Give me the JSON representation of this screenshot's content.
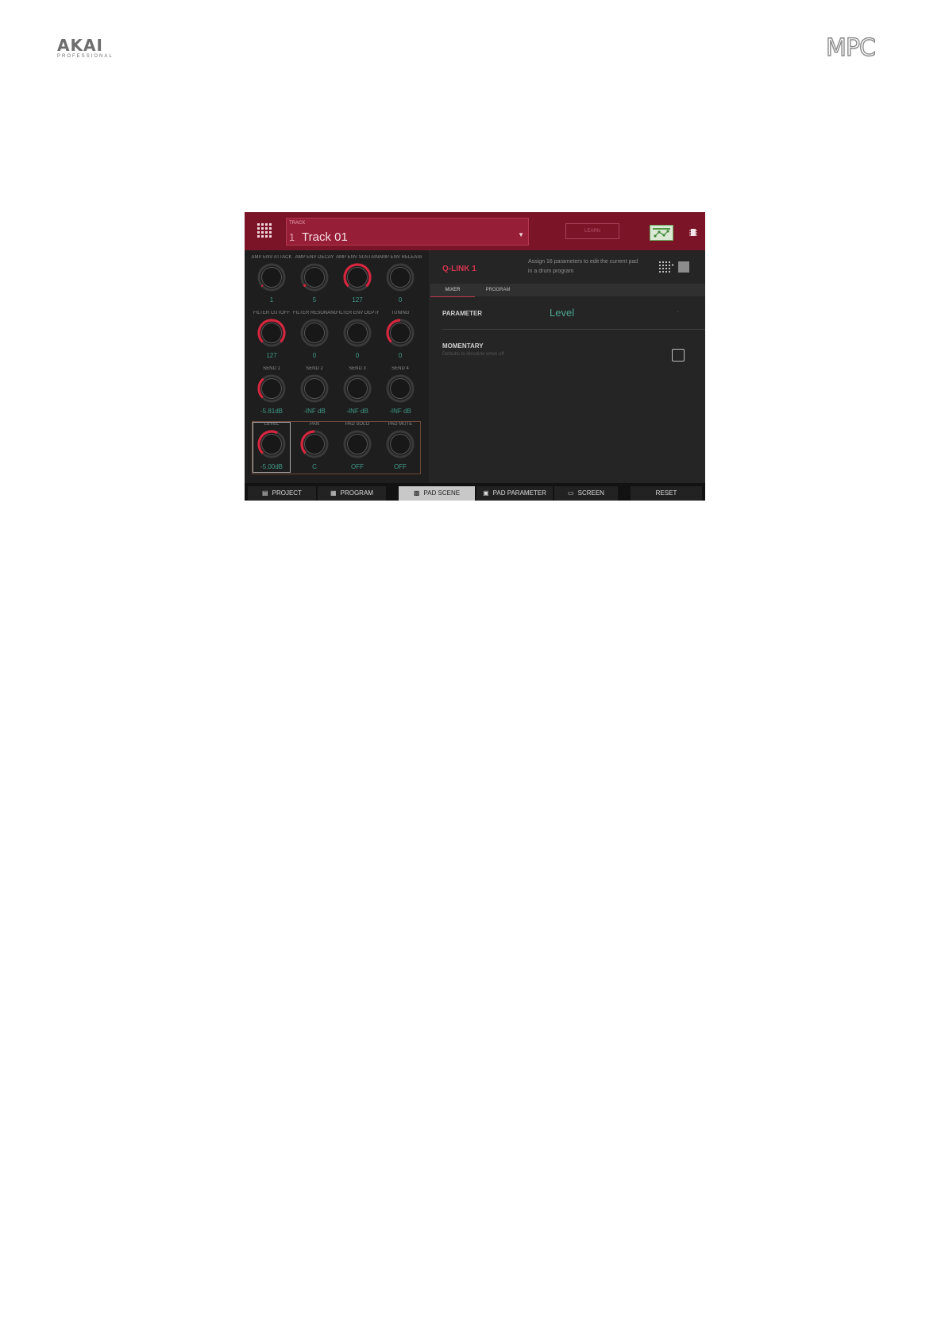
{
  "page": {
    "brand_left": "AKAI",
    "brand_left_sub": "PROFESSIONAL",
    "brand_right": "MPC"
  },
  "header": {
    "track_label": "TRACK",
    "track_number": "1",
    "track_name": "Track 01",
    "learn_label": "LEARN"
  },
  "knobs": [
    {
      "label": "AMP ENV ATTACK",
      "value": "1",
      "level": 0.01
    },
    {
      "label": "AMP ENV DECAY",
      "value": "5",
      "level": 0.04
    },
    {
      "label": "AMP ENV SUSTAIN",
      "value": "127",
      "level": 1.0
    },
    {
      "label": "AMP ENV RELEASE",
      "value": "0",
      "level": 0.0
    },
    {
      "label": "FILTER CUTOFF",
      "value": "127",
      "level": 1.0
    },
    {
      "label": "FILTER RESONANCE",
      "value": "0",
      "level": 0.0
    },
    {
      "label": "FILTER ENV DEPTH",
      "value": "0",
      "level": 0.0
    },
    {
      "label": "TUNING",
      "value": "0",
      "level": 0.5
    },
    {
      "label": "SEND 1",
      "value": "-5.81dB",
      "level": 0.35
    },
    {
      "label": "SEND 2",
      "value": "-INF dB",
      "level": 0.0
    },
    {
      "label": "SEND 3",
      "value": "-INF dB",
      "level": 0.0
    },
    {
      "label": "SEND 4",
      "value": "-INF dB",
      "level": 0.0
    },
    {
      "label": "LEVEL",
      "value": "-5.00dB",
      "level": 0.6
    },
    {
      "label": "PAN",
      "value": "C",
      "level": 0.5
    },
    {
      "label": "PAD SOLO",
      "value": "OFF",
      "level": 0.0
    },
    {
      "label": "PAD MUTE",
      "value": "OFF",
      "level": 0.0
    }
  ],
  "qlink": {
    "title": "Q-LINK 1",
    "description": "Assign 16 parameters to edit the current pad in a drum program",
    "tabs": [
      "MIXER",
      "PROGRAM"
    ],
    "parameter_label": "PARAMETER",
    "parameter_value": "Level",
    "parameter_dash": "-",
    "momentary_label": "MOMENTARY",
    "momentary_sub": "Defaults to Absolute when off",
    "momentary_checked": false
  },
  "bottom": {
    "buttons": [
      "PROJECT",
      "PROGRAM",
      "PAD SCENE",
      "PAD PARAMETER",
      "SCREEN"
    ],
    "active": "PAD SCENE",
    "reset": "RESET"
  },
  "colors": {
    "topbar": "#7a1426",
    "accent": "#d6344f",
    "value_teal": "#3f9a86",
    "knob_arc": "#d4263f"
  }
}
